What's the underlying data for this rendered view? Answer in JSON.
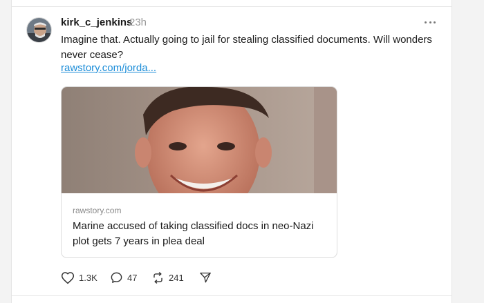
{
  "post": {
    "username": "kirk_c_jenkins",
    "timestamp": "23h",
    "text": "Imagine that. Actually going to jail for stealing classified documents. Will wonders never cease?",
    "link_text": "rawstory.com/jorda..."
  },
  "link_card": {
    "domain": "rawstory.com",
    "title": "Marine accused of taking classified docs in neo-Nazi plot gets 7 years in plea deal"
  },
  "actions": {
    "likes": "1.3K",
    "replies": "47",
    "reposts": "241"
  },
  "icons": {
    "more": "more-horizontal-icon",
    "like": "heart-icon",
    "reply": "comment-icon",
    "repost": "repost-icon",
    "share": "send-icon"
  },
  "colors": {
    "link": "#1a8cd8",
    "muted": "#999999",
    "text": "#1a1a1a"
  }
}
